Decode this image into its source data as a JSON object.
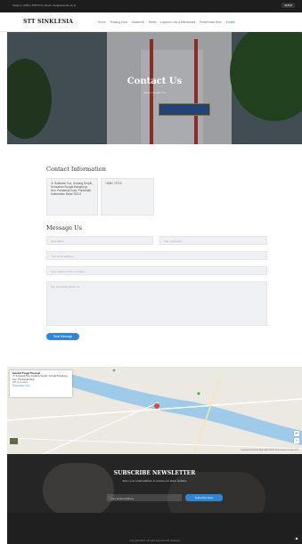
{
  "topbar": {
    "contact": "Telepon: (0561) 6587070 | Email: info@stiesmkr.ac.id",
    "badge": "SMKR"
  },
  "nav": {
    "logo": "STT SINKLESIA",
    "items": [
      {
        "label": "Home",
        "active": false
      },
      {
        "label": "Tentang Kami",
        "active": false
      },
      {
        "label": "Akademik",
        "active": false
      },
      {
        "label": "Berita",
        "active": false
      },
      {
        "label": "Layanan Unit & Mahasiswa",
        "active": false
      },
      {
        "label": "Penerimaan Baru",
        "active": false
      },
      {
        "label": "Kontak",
        "active": true
      }
    ]
  },
  "hero": {
    "title": "Contact Us",
    "breadcrumb": "Home / Contact Us"
  },
  "contact_info": {
    "title": "Contact Information",
    "address": "Jl. Sulawesi Tua, Gudang Serpih, Kelurahan Sungai Bangkong, Kec. Pontianak Kota, Pontianak, Kalimantan Barat 78113",
    "phone": "+6281 73712"
  },
  "message_form": {
    "title": "Message Us",
    "firstname_placeholder": "First Name",
    "lastname_placeholder": "Your Lastname",
    "email_placeholder": "Your email address",
    "subject_placeholder": "Your subject of the message",
    "message_placeholder": "Say something about us",
    "send_label": "Send Message"
  },
  "map": {
    "place_name": "Sekolah Tinggi Theologi",
    "place_address": "Jl. Sulawesi Tua, Gudang Serpih, Sungai Bangkong, Kec. Pontianak Kota",
    "rating": "4.5",
    "reviews_link": "10 reviews",
    "larger_map_link": "View larger map",
    "footer": "Keyboard shortcuts  Map data ©2023  Terms  Report a map error",
    "zoom_in": "+",
    "zoom_out": "−"
  },
  "newsletter": {
    "title": "SUBSCRIBE NEWSLETTER",
    "description": "Enter your email address to receive our latest updates",
    "email_placeholder": "Your Email Address",
    "subscribe_label": "Subscribe Now"
  },
  "footer": {
    "copyright": "Copyright 2023. All rights reserved STT Sinklesia"
  },
  "colors": {
    "accent": "#2f86d6",
    "dark": "#1f1f1f"
  }
}
